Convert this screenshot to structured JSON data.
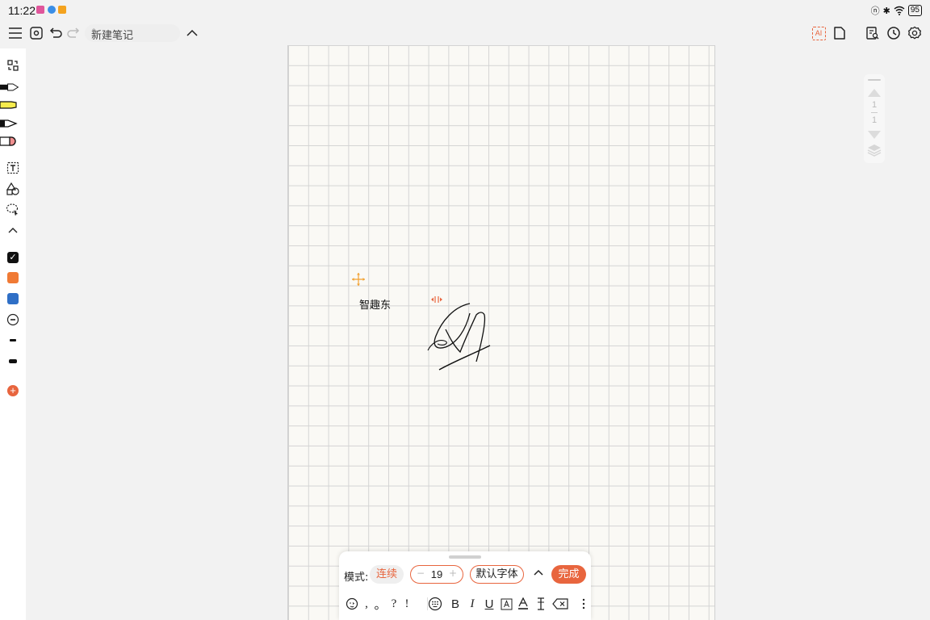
{
  "status": {
    "time": "11:22",
    "battery": "95"
  },
  "toolbar": {
    "title": "新建笔记",
    "ai_label": "AI"
  },
  "canvas": {
    "text": "智趣东"
  },
  "pager": {
    "current": "1",
    "total": "1"
  },
  "panel": {
    "mode_label": "模式:",
    "mode_value": "连续",
    "size_minus": "−",
    "size_value": "19",
    "size_plus": "+",
    "font": "默认字体",
    "done": "完成",
    "punct": [
      ",",
      "。",
      "?",
      "!"
    ],
    "format": [
      "B",
      "I",
      "U"
    ]
  },
  "colors": {
    "accent": "#e8653e",
    "swatch_black": "#111111",
    "swatch_orange": "#f07a35",
    "swatch_blue": "#2f6fc6"
  }
}
